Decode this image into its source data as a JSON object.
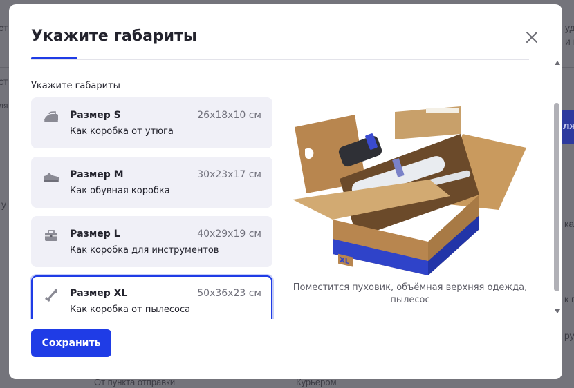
{
  "background": {
    "frags": [
      "ст",
      "уд",
      "и п",
      "ст",
      "ля",
      "у",
      "ка",
      "к п",
      "ру",
      "От пункта отправки",
      "Курьером"
    ],
    "button_text": "лж"
  },
  "modal": {
    "title": "Укажите габариты",
    "section_label": "Укажите габариты",
    "sizes": [
      {
        "name": "Размер S",
        "dims": "26x18x10 см",
        "desc": "Как коробка от утюга",
        "icon": "iron-icon",
        "selected": false
      },
      {
        "name": "Размер M",
        "dims": "30x23x17 см",
        "desc": "Как обувная коробка",
        "icon": "shoe-icon",
        "selected": false
      },
      {
        "name": "Размер L",
        "dims": "40x29x19 см",
        "desc": "Как коробка для инструментов",
        "icon": "toolbox-icon",
        "selected": false
      },
      {
        "name": "Размер XL",
        "dims": "50x36x23 см",
        "desc": "Как коробка от пылесоса",
        "icon": "vacuum-icon",
        "selected": true
      }
    ],
    "illustration": {
      "box_label": "XL",
      "caption": "Поместится пуховик, объёмная верхняя одежда, пылесос"
    },
    "save_label": "Сохранить"
  },
  "colors": {
    "accent": "#1f3ce6",
    "card_bg": "#f0f0f7",
    "overlay": "#74747b"
  }
}
